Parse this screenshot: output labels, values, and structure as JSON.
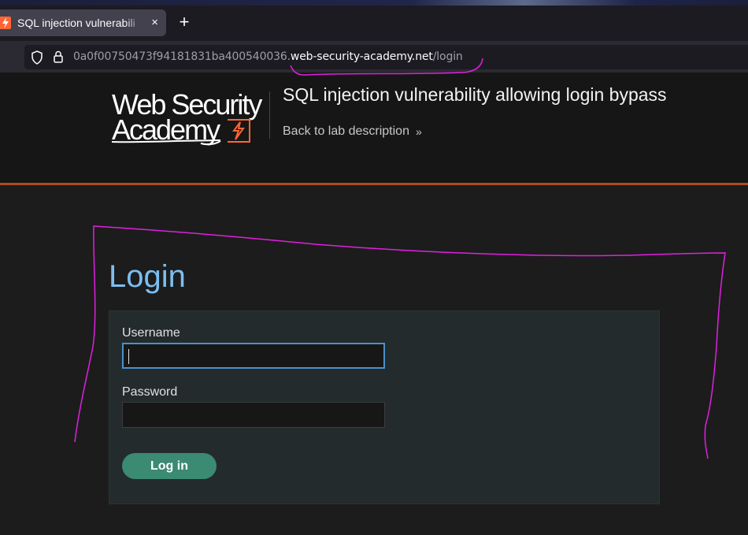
{
  "browser": {
    "tab": {
      "title": "SQL injection vulnerabili",
      "close_glyph": "×",
      "favicon": "portswigger-bolt-icon"
    },
    "new_tab_glyph": "+",
    "url": {
      "subdomain": "0a0f00750473f94181831ba400540036.",
      "domain": "web-security-academy.net",
      "path": "/login"
    }
  },
  "header": {
    "logo_line1": "Web Security",
    "logo_line2": "Academy",
    "lab_title": "SQL injection vulnerability allowing login bypass",
    "back_link": "Back to lab description",
    "back_chevrons": "»",
    "accent_color": "#ae4d1e"
  },
  "login": {
    "heading": "Login",
    "username_label": "Username",
    "username_value": "",
    "password_label": "Password",
    "password_value": "",
    "submit_label": "Log in"
  },
  "colors": {
    "heading": "#7cbef0",
    "button": "#3b8a72",
    "annotation": "#e020e0"
  }
}
